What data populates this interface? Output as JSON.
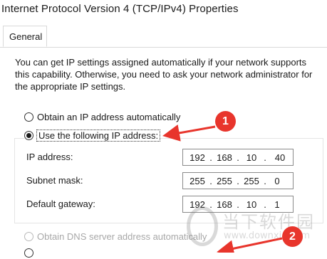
{
  "window": {
    "title": "Internet Protocol Version 4 (TCP/IPv4) Properties"
  },
  "tabs": [
    {
      "label": "General",
      "selected": true
    }
  ],
  "intro_text": "You can get IP settings assigned automatically if your network supports this capability. Otherwise, you need to ask your network administrator for the appropriate IP settings.",
  "ip_options": {
    "auto": {
      "label": "Obtain an IP address automatically",
      "checked": false
    },
    "manual": {
      "label": "Use the following IP address:",
      "checked": true
    }
  },
  "fields": {
    "ip_address": {
      "label": "IP address:",
      "octets": [
        "192",
        "168",
        "10",
        "40"
      ]
    },
    "subnet_mask": {
      "label": "Subnet mask:",
      "octets": [
        "255",
        "255",
        "255",
        "0"
      ]
    },
    "default_gateway": {
      "label": "Default gateway:",
      "octets": [
        "192",
        "168",
        "10",
        "1"
      ]
    }
  },
  "dns_options": {
    "auto": {
      "label": "Obtain DNS server address automatically",
      "checked": false,
      "enabled": false
    }
  },
  "annotations": {
    "marker1": "1",
    "marker2": "2",
    "color": "#e8352c"
  },
  "watermark": {
    "text": "当下软件园",
    "url": "www.downxia.com"
  }
}
